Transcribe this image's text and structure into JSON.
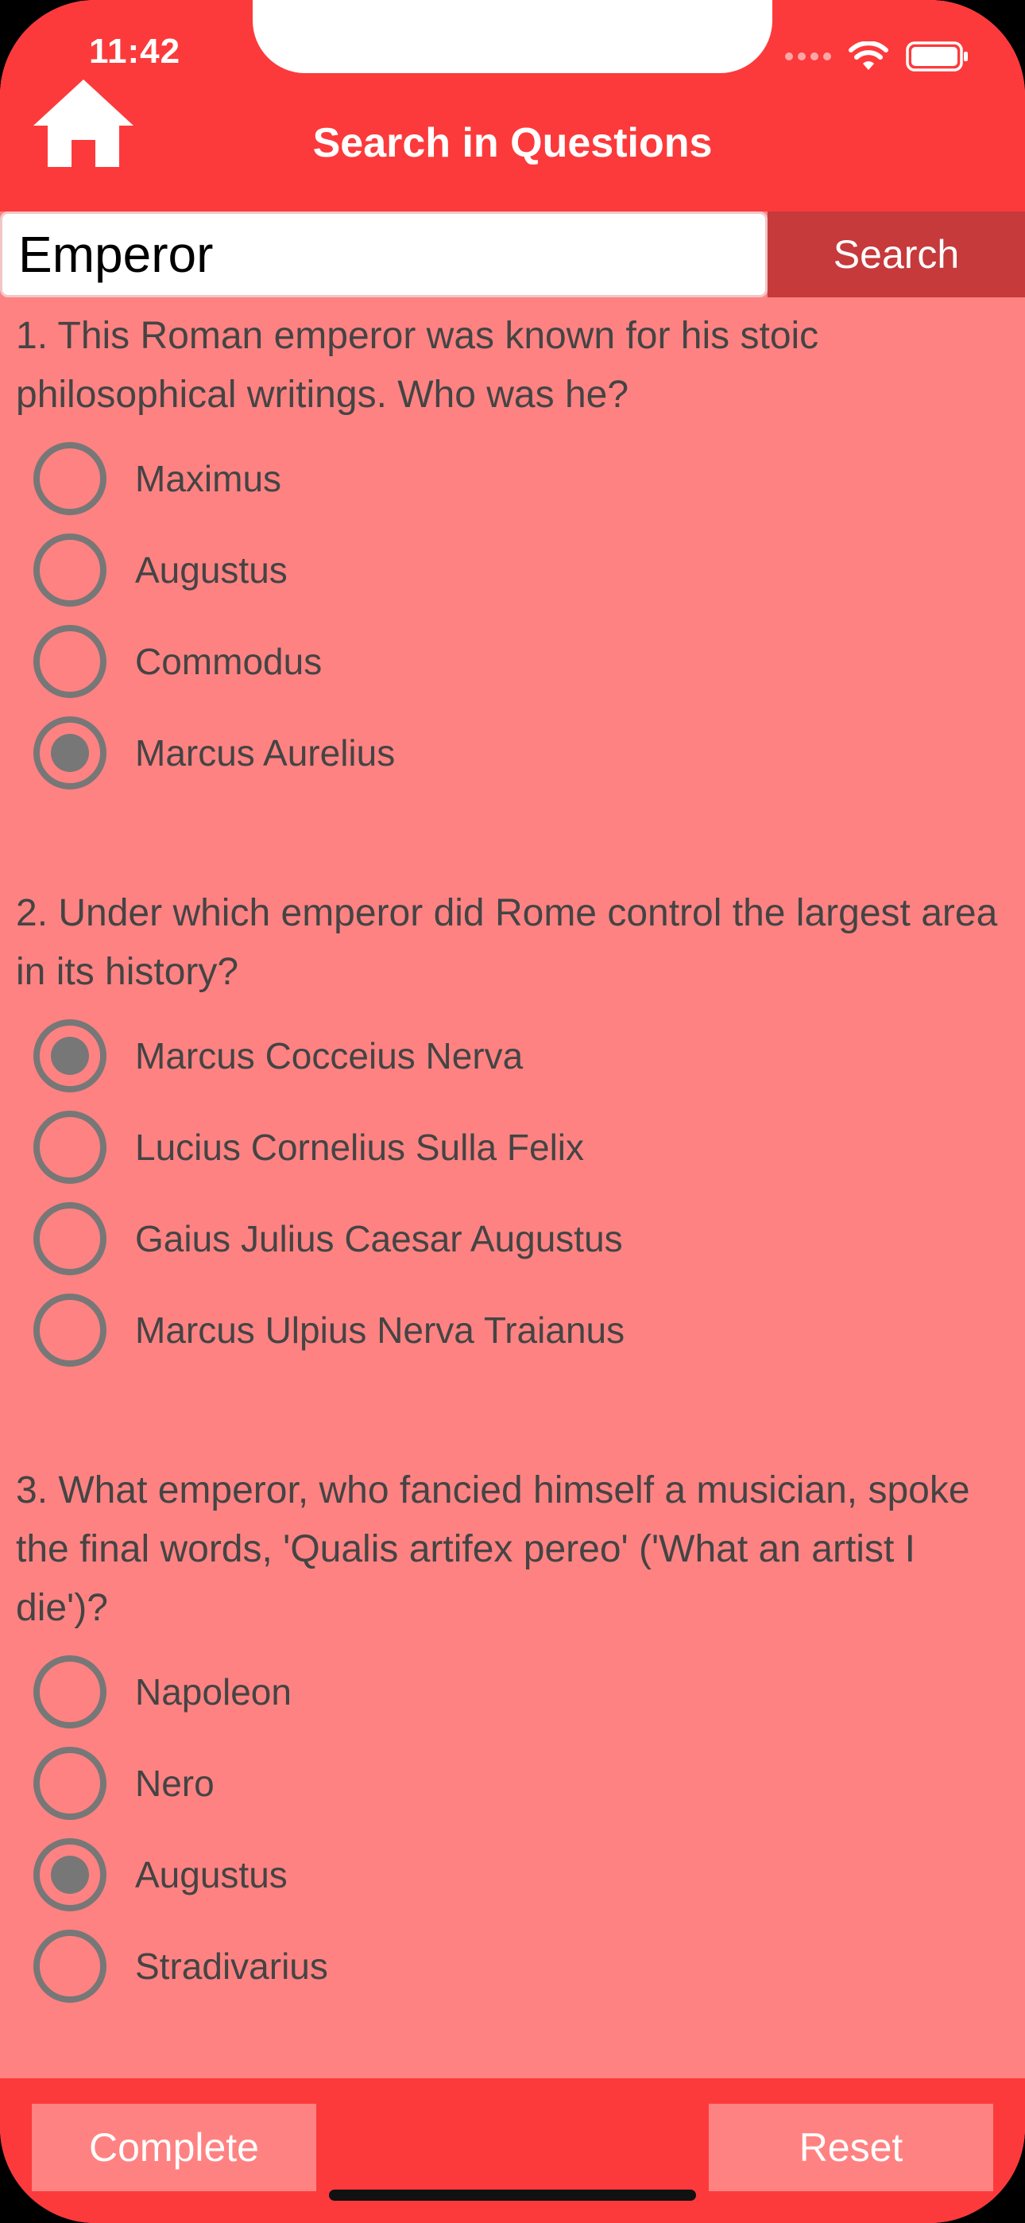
{
  "status_bar": {
    "time": "11:42"
  },
  "header": {
    "title": "Search in Questions",
    "home_icon": "house-icon"
  },
  "search": {
    "value": "Emperor",
    "button_label": "Search"
  },
  "questions": [
    {
      "text": "1. This Roman emperor was known for his stoic philosophical writings. Who was he?",
      "options": [
        {
          "label": "Maximus",
          "selected": false
        },
        {
          "label": "Augustus",
          "selected": false
        },
        {
          "label": "Commodus",
          "selected": false
        },
        {
          "label": "Marcus Aurelius",
          "selected": true
        }
      ]
    },
    {
      "text": "2. Under which emperor did Rome control the largest area in its history?",
      "options": [
        {
          "label": "Marcus Cocceius Nerva",
          "selected": true
        },
        {
          "label": "Lucius Cornelius Sulla Felix",
          "selected": false
        },
        {
          "label": "Gaius Julius Caesar Augustus",
          "selected": false
        },
        {
          "label": "Marcus Ulpius Nerva Traianus",
          "selected": false
        }
      ]
    },
    {
      "text": "3. What emperor, who fancied himself a musician, spoke the final words, 'Qualis artifex pereo' ('What an artist I die')?",
      "options": [
        {
          "label": "Napoleon",
          "selected": false
        },
        {
          "label": "Nero",
          "selected": false
        },
        {
          "label": "Augustus",
          "selected": true
        },
        {
          "label": "Stradivarius",
          "selected": false
        }
      ]
    }
  ],
  "footer": {
    "complete_label": "Complete",
    "reset_label": "Reset"
  },
  "colors": {
    "header_bg": "#fc3a3b",
    "content_bg": "#ff8282",
    "search_button_bg": "#c63a3c",
    "radio": "#777777"
  }
}
